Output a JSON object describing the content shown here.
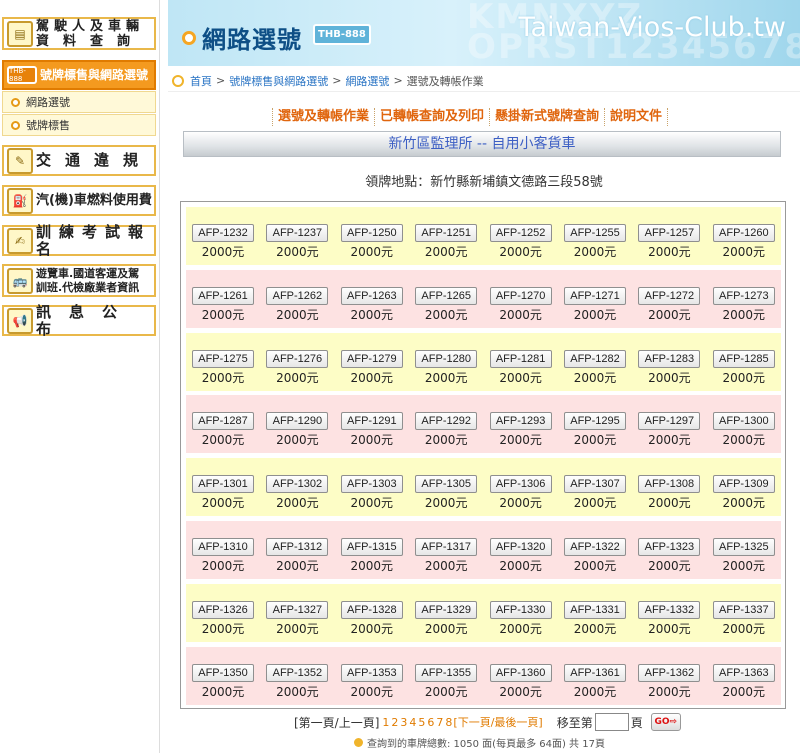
{
  "sidebar": {
    "items": [
      {
        "label_1": "駕駛人及車輛",
        "label_2": "資料查詢",
        "icon": "car-info-icon"
      },
      {
        "label_1": "號牌標售與網路選號",
        "icon": "plate-icon",
        "icon_text": "THB-888"
      },
      {
        "label_1": "交通違規",
        "icon": "traffic-violation-icon"
      },
      {
        "label_1": "汽(機)車燃料使用費",
        "icon": "fuel-fee-icon"
      },
      {
        "label_1": "訓練考試報名",
        "icon": "exam-registration-icon"
      },
      {
        "label_1": "遊覽車.國道客運及駕",
        "label_2": "訓班.代檢廠業者資訊",
        "icon": "bus-icon"
      },
      {
        "label_1": "訊息公布",
        "icon": "announcement-icon"
      }
    ],
    "subitems": [
      "網路選號",
      "號牌標售"
    ]
  },
  "header": {
    "title": "網路選號",
    "plate": "THB-888",
    "watermark": "Taiwan-Vios-Club.tw"
  },
  "breadcrumb": [
    "首頁",
    "號牌標售與網路選號",
    "網路選號",
    "選號及轉帳作業"
  ],
  "tabs": [
    "選號及轉帳作業",
    "已轉帳查詢及列印",
    "懸掛新式號牌查詢",
    "說明文件"
  ],
  "section_title": "新竹區監理所 -- 自用小客貨車",
  "location_text": "領牌地點：新竹縣新埔鎮文德路三段58號",
  "plates": [
    [
      "AFP-1232",
      "AFP-1237",
      "AFP-1250",
      "AFP-1251",
      "AFP-1252",
      "AFP-1255",
      "AFP-1257",
      "AFP-1260"
    ],
    [
      "AFP-1261",
      "AFP-1262",
      "AFP-1263",
      "AFP-1265",
      "AFP-1270",
      "AFP-1271",
      "AFP-1272",
      "AFP-1273"
    ],
    [
      "AFP-1275",
      "AFP-1276",
      "AFP-1279",
      "AFP-1280",
      "AFP-1281",
      "AFP-1282",
      "AFP-1283",
      "AFP-1285"
    ],
    [
      "AFP-1287",
      "AFP-1290",
      "AFP-1291",
      "AFP-1292",
      "AFP-1293",
      "AFP-1295",
      "AFP-1297",
      "AFP-1300"
    ],
    [
      "AFP-1301",
      "AFP-1302",
      "AFP-1303",
      "AFP-1305",
      "AFP-1306",
      "AFP-1307",
      "AFP-1308",
      "AFP-1309"
    ],
    [
      "AFP-1310",
      "AFP-1312",
      "AFP-1315",
      "AFP-1317",
      "AFP-1320",
      "AFP-1322",
      "AFP-1323",
      "AFP-1325"
    ],
    [
      "AFP-1326",
      "AFP-1327",
      "AFP-1328",
      "AFP-1329",
      "AFP-1330",
      "AFP-1331",
      "AFP-1332",
      "AFP-1337"
    ],
    [
      "AFP-1350",
      "AFP-1352",
      "AFP-1353",
      "AFP-1355",
      "AFP-1360",
      "AFP-1361",
      "AFP-1362",
      "AFP-1363"
    ]
  ],
  "price": "2000元",
  "pager": {
    "first_prev": "[第一頁/上一頁]",
    "pages": [
      "1",
      "2",
      "3",
      "4",
      "5",
      "6",
      "7",
      "8"
    ],
    "next_last": "[下一頁/最後一頁]",
    "goto_prefix": "移至第",
    "goto_suffix": "頁",
    "go_label": "GO"
  },
  "total_text": "查詢到的車牌總數: 1050 面(每頁最多 64面) 共 17頁"
}
